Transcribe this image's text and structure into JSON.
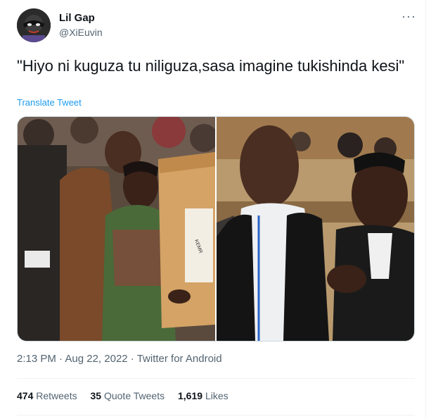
{
  "author": {
    "name": "Lil Gap",
    "handle": "@XiEuvin",
    "avatar_icon": "masked-character-avatar"
  },
  "menu": {
    "more_icon": "more-horizontal-icon",
    "more_glyph": "···"
  },
  "tweet": {
    "text": "\"Hiyo ni kuguza tu niliguza,sasa imagine tukishinda kesi\"",
    "translate_label": "Translate Tweet"
  },
  "media": {
    "left_photo": {
      "box_label": "KEMR"
    },
    "right_photo": {}
  },
  "meta": {
    "time": "2:13 PM",
    "separator1": " · ",
    "date": "Aug 22, 2022",
    "separator2": " · ",
    "source": "Twitter for Android"
  },
  "stats": {
    "retweets_count": "474",
    "retweets_label": "Retweets",
    "quotes_count": "35",
    "quotes_label": "Quote Tweets",
    "likes_count": "1,619",
    "likes_label": "Likes"
  },
  "colors": {
    "link": "#1d9bf0",
    "secondary_text": "#536471",
    "primary_text": "#0f1419",
    "divider": "#eff3f4"
  }
}
